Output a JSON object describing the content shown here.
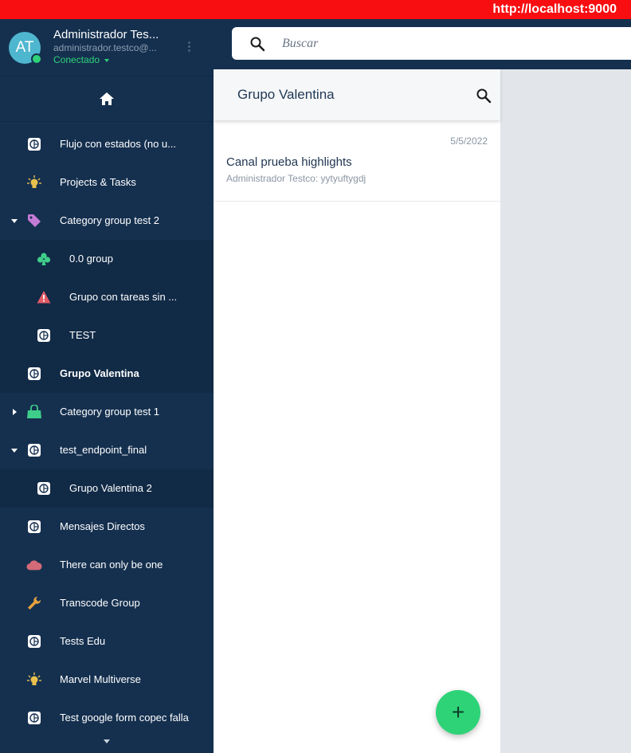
{
  "url_bar": {
    "url": "http://localhost:9000"
  },
  "profile": {
    "initials": "AT",
    "name": "Administrador Tes...",
    "email": "administrador.testco@...",
    "status": "Conectado"
  },
  "search": {
    "placeholder": "Buscar"
  },
  "sidebar": {
    "items": [
      {
        "label": "Flujo con estados (no u...",
        "icon": "channel-globe-icon",
        "icon_color": "#ffffff",
        "level": 0,
        "expander": "none"
      },
      {
        "label": "Projects & Tasks",
        "icon": "lightbulb-icon",
        "icon_color": "#e8c04e",
        "level": 0,
        "expander": "none"
      },
      {
        "label": "Category group test 2",
        "icon": "tag-icon",
        "icon_color": "#c47bd6",
        "level": 0,
        "expander": "expanded"
      },
      {
        "label": "0.0 group",
        "icon": "club-icon",
        "icon_color": "#3fce8a",
        "level": 1,
        "expander": "none"
      },
      {
        "label": "Grupo con tareas sin ...",
        "icon": "warning-icon",
        "icon_color": "#e05a66",
        "level": 1,
        "expander": "none"
      },
      {
        "label": "TEST",
        "icon": "channel-globe-icon",
        "icon_color": "#ffffff",
        "level": 1,
        "expander": "none"
      },
      {
        "label": "Grupo Valentina",
        "icon": "channel-globe-icon",
        "icon_color": "#ffffff",
        "level": 0,
        "expander": "none",
        "active": true
      },
      {
        "label": "Category group test 1",
        "icon": "shopping-bag-icon",
        "icon_color": "#3fce8a",
        "level": 0,
        "expander": "collapsed"
      },
      {
        "label": "test_endpoint_final",
        "icon": "channel-globe-icon",
        "icon_color": "#ffffff",
        "level": 0,
        "expander": "expanded"
      },
      {
        "label": "Grupo Valentina 2",
        "icon": "channel-globe-icon",
        "icon_color": "#ffffff",
        "level": 1,
        "expander": "none"
      },
      {
        "label": "Mensajes Directos",
        "icon": "channel-globe-icon",
        "icon_color": "#ffffff",
        "level": 0,
        "expander": "none"
      },
      {
        "label": "There can only be one",
        "icon": "cloud-icon",
        "icon_color": "#d46a78",
        "level": 0,
        "expander": "none"
      },
      {
        "label": "Transcode Group",
        "icon": "wrench-icon",
        "icon_color": "#e8a23e",
        "level": 0,
        "expander": "none"
      },
      {
        "label": "Tests Edu",
        "icon": "channel-globe-icon",
        "icon_color": "#ffffff",
        "level": 0,
        "expander": "none"
      },
      {
        "label": "Marvel Multiverse",
        "icon": "lightbulb-icon",
        "icon_color": "#e8c04e",
        "level": 0,
        "expander": "none"
      },
      {
        "label": "Test google form copec falla",
        "icon": "channel-globe-icon",
        "icon_color": "#ffffff",
        "level": 0,
        "expander": "none"
      }
    ]
  },
  "panel": {
    "title": "Grupo Valentina",
    "channels": [
      {
        "date": "5/5/2022",
        "name": "Canal prueba highlights",
        "last_message": "Administrador Testco: yytyuftygdj"
      }
    ]
  },
  "fab": {
    "label": "+"
  },
  "colors": {
    "sidebar_bg": "#15304f",
    "accent_green": "#2ed378",
    "url_bar": "#f80d10"
  }
}
